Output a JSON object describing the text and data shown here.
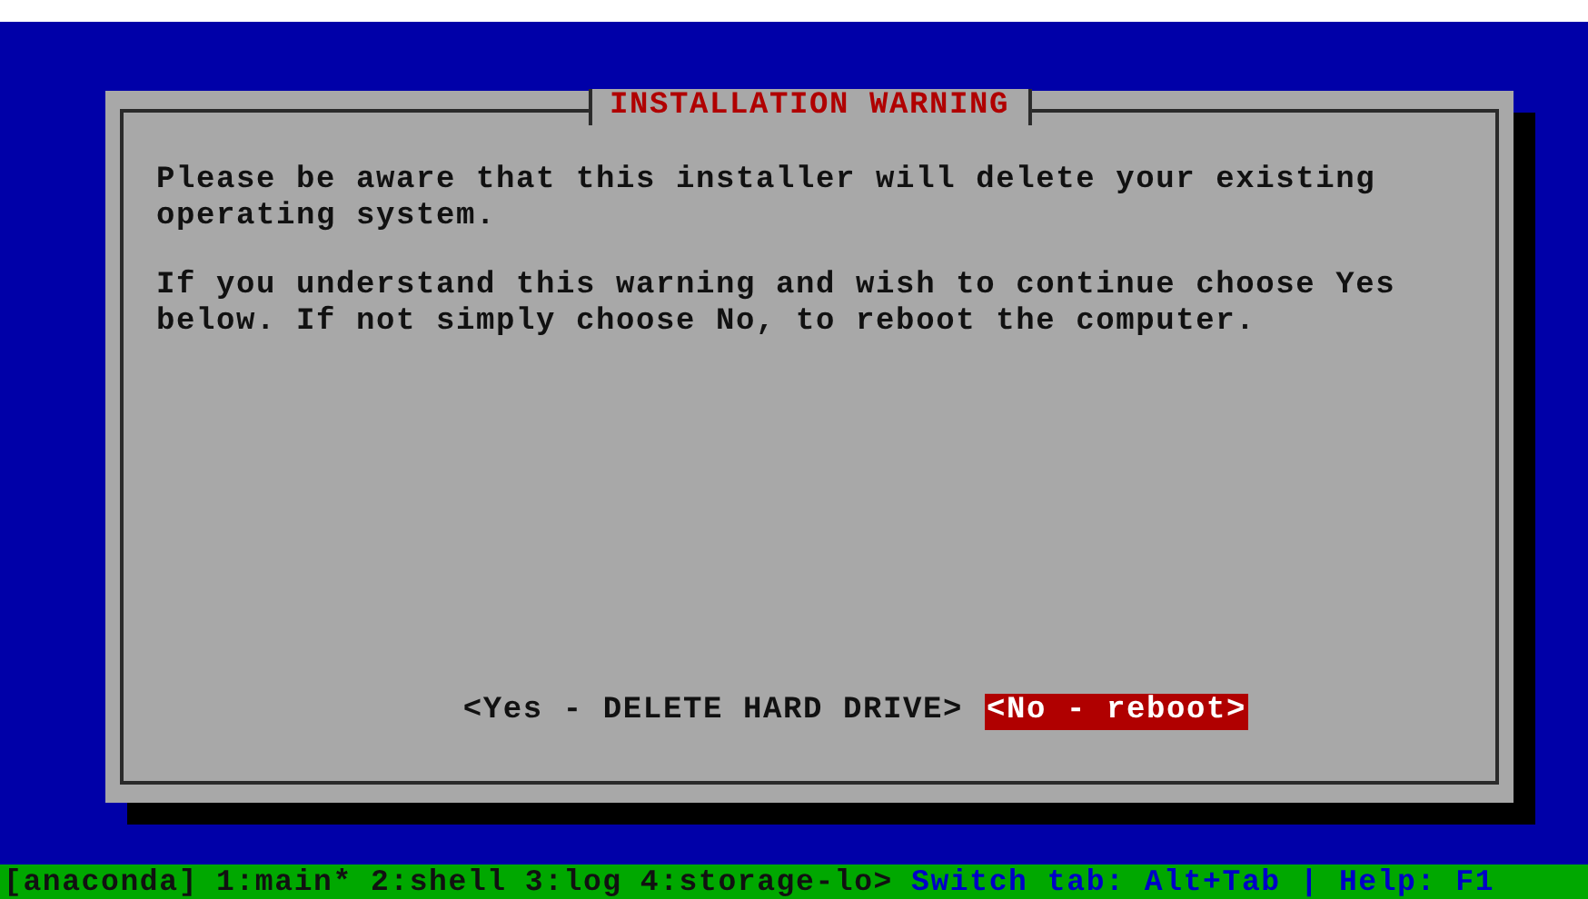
{
  "dialog": {
    "title": "INSTALLATION WARNING",
    "paragraphs": [
      "Please be aware that this installer will delete your existing operating system.",
      "If you understand this warning and wish to continue choose Yes below. If not simply choose No, to reboot the computer."
    ],
    "buttons": [
      {
        "label": "<Yes - DELETE HARD DRIVE>",
        "selected": false
      },
      {
        "label": "<No - reboot>",
        "selected": true
      }
    ]
  },
  "status_bar": {
    "session": "[anaconda]",
    "windows": [
      "1:main*",
      "2:shell",
      "3:log",
      "4:storage-lo>"
    ],
    "hint": "Switch tab: Alt+Tab | Help: F1"
  }
}
